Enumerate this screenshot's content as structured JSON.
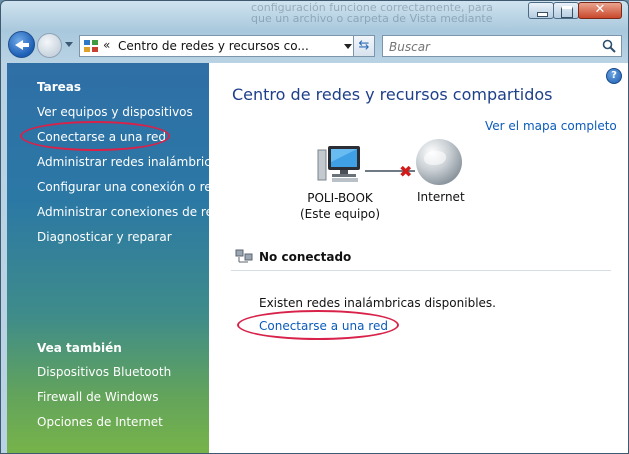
{
  "window": {
    "ghost_text": "configuración funcione correctamente, para que un archivo o carpeta de Vista mediante las para que el archivo"
  },
  "nav": {
    "address_chevron": "«",
    "address_path": "Centro de redes y recursos co...",
    "search_placeholder": "Buscar"
  },
  "sidebar": {
    "tasks_heading": "Tareas",
    "tasks": [
      "Ver equipos y dispositivos",
      "Conectarse a una red",
      "Administrar redes inalámbricas",
      "Configurar una conexión o red",
      "Administrar conexiones de red",
      "Diagnosticar y reparar"
    ],
    "see_also_heading": "Vea también",
    "see_also": [
      "Dispositivos Bluetooth",
      "Firewall de Windows",
      "Opciones de Internet"
    ]
  },
  "main": {
    "help": "?",
    "title": "Centro de redes y recursos compartidos",
    "map_link": "Ver el mapa completo",
    "computer_name": "POLI-BOOK",
    "computer_note": "(Este equipo)",
    "internet_label": "Internet",
    "status": "No conectado",
    "available_text": "Existen redes inalámbricas disponibles.",
    "connect_link": "Conectarse a una red"
  },
  "colors": {
    "link": "#0b5bbb",
    "title": "#1e3f8a",
    "annotation": "#d8224a"
  }
}
